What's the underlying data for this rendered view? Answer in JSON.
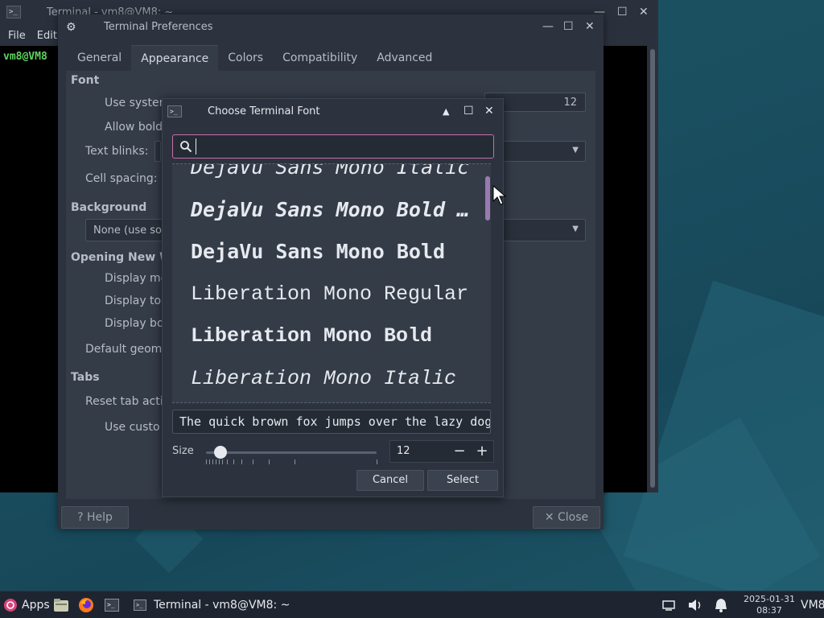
{
  "terminal": {
    "title": "Terminal - vm8@VM8: ~",
    "menu": [
      "File",
      "Edit"
    ],
    "prompt": "vm8@VM8"
  },
  "preferences": {
    "title": "Terminal Preferences",
    "tabs": [
      "General",
      "Appearance",
      "Colors",
      "Compatibility",
      "Advanced"
    ],
    "active_tab": "Appearance",
    "sections": {
      "font": "Font",
      "background": "Background",
      "opening": "Opening New W",
      "tabs": "Tabs"
    },
    "items": {
      "use_system": "Use system",
      "allow_bold": "Allow bold",
      "text_blinks": "Text blinks:",
      "cell_spacing": "Cell spacing:",
      "background_select": "None (use so",
      "display_menu": "Display me",
      "display_toolbar": "Display too",
      "display_borders": "Display bo",
      "default_geometry": "Default geome",
      "reset_tab": "Reset tab acti",
      "use_custom": "Use custo",
      "font_size_value": "12"
    },
    "help_label": "Help",
    "close_label": "Close"
  },
  "font_dialog": {
    "title": "Choose Terminal Font",
    "search_value": "",
    "fonts": [
      {
        "label": "DejaVu Sans Mono Italic",
        "style": "f-ital"
      },
      {
        "label": "DejaVu Sans Mono Bold …",
        "style": "f-bi"
      },
      {
        "label": "DejaVu Sans Mono Bold",
        "style": "f-bold"
      },
      {
        "label": "Liberation Mono Regular",
        "style": "f-lreg"
      },
      {
        "label": "Liberation Mono Bold",
        "style": "f-lbold"
      },
      {
        "label": "Liberation Mono Italic",
        "style": "f-lital"
      }
    ],
    "preview_text": "The quick brown fox jumps over the lazy dog",
    "size_label": "Size",
    "size_value": "12",
    "minus_label": "−",
    "plus_label": "+",
    "cancel_label": "Cancel",
    "select_label": "Select"
  },
  "taskbar": {
    "apps_label": "Apps",
    "task_label": "Terminal - vm8@VM8: ~",
    "date": "2025-01-31",
    "time": "08:37",
    "user": "VM8"
  },
  "colors": {
    "accent": "#c66fa8",
    "scroll_thumb": "#9a7ab0",
    "prompt_green": "#5fd35f"
  }
}
